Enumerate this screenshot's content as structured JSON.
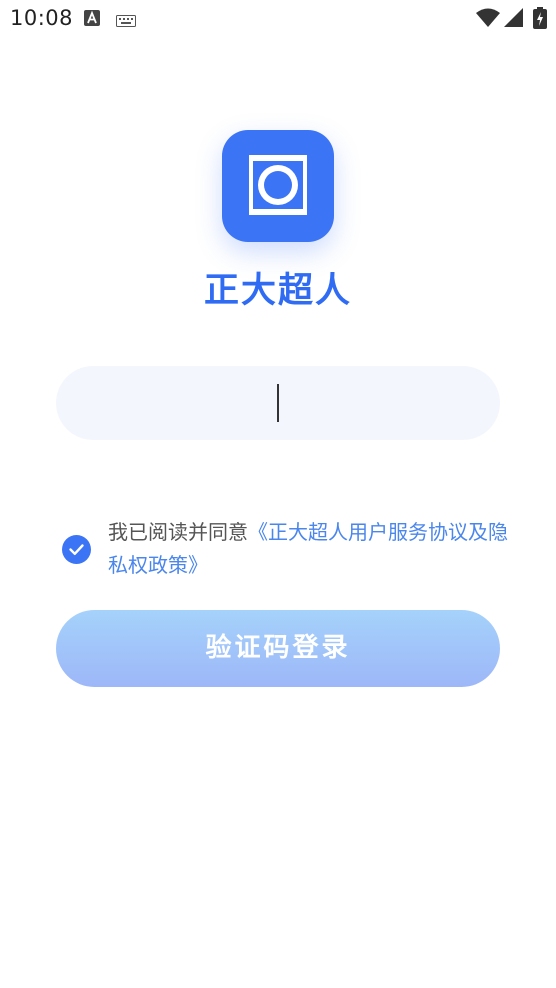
{
  "status_bar": {
    "time": "10:08",
    "icons": [
      "font-icon",
      "keyboard-icon",
      "wifi-icon",
      "signal-icon",
      "battery-charging-icon"
    ]
  },
  "app": {
    "name": "正大超人",
    "logo_icon": "app-logo-icon",
    "brand_color": "#3c74f6"
  },
  "phone_input": {
    "value": "",
    "placeholder": ""
  },
  "agreement": {
    "checked": true,
    "prefix_text": "我已阅读并同意",
    "link_text": "《正大超人用户服务协议及隐私权政策》",
    "link_color": "#4a86ec"
  },
  "login_button": {
    "label": "验证码登录"
  }
}
